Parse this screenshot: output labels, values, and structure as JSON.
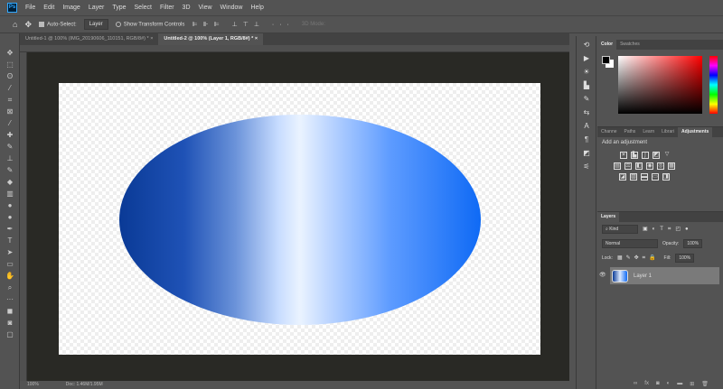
{
  "app": {
    "logo": "Ps"
  },
  "menu": [
    "File",
    "Edit",
    "Image",
    "Layer",
    "Type",
    "Select",
    "Filter",
    "3D",
    "View",
    "Window",
    "Help"
  ],
  "options": {
    "auto_select_label": "Auto-Select:",
    "auto_select_value": "Layer",
    "show_transform_label": "Show Transform Controls",
    "mode_3d": "3D Mode:"
  },
  "tabs": [
    {
      "label": "Untitled-1 @ 100% (IMG_20190606_110151, RGB/8#) *",
      "active": false
    },
    {
      "label": "Untitled-2 @ 100% (Layer 1, RGB/8#) *",
      "active": true
    }
  ],
  "color_panel": {
    "tabs": [
      "Color",
      "Swatches"
    ],
    "active": "Color",
    "foreground": "#000000",
    "background": "#ffffff",
    "hue": "#ff0000"
  },
  "adjust_panel": {
    "tabs": [
      "Channe",
      "Paths",
      "Learn",
      "Librari",
      "Adjustments"
    ],
    "active": "Adjustments",
    "hint": "Add an adjustment"
  },
  "layers_panel": {
    "tab": "Layers",
    "filter": "Kind",
    "blend_mode": "Normal",
    "opacity_label": "Opacity:",
    "opacity": "100%",
    "lock_label": "Lock:",
    "fill_label": "Fill:",
    "fill": "100%",
    "layers": [
      {
        "name": "Layer 1",
        "visible": true
      }
    ]
  },
  "status": {
    "zoom": "100%",
    "doc": "Doc: 1.46M/1.95M"
  },
  "gradient_colors": [
    "#0a3a96",
    "#eaf3ff",
    "#0f6af5"
  ]
}
